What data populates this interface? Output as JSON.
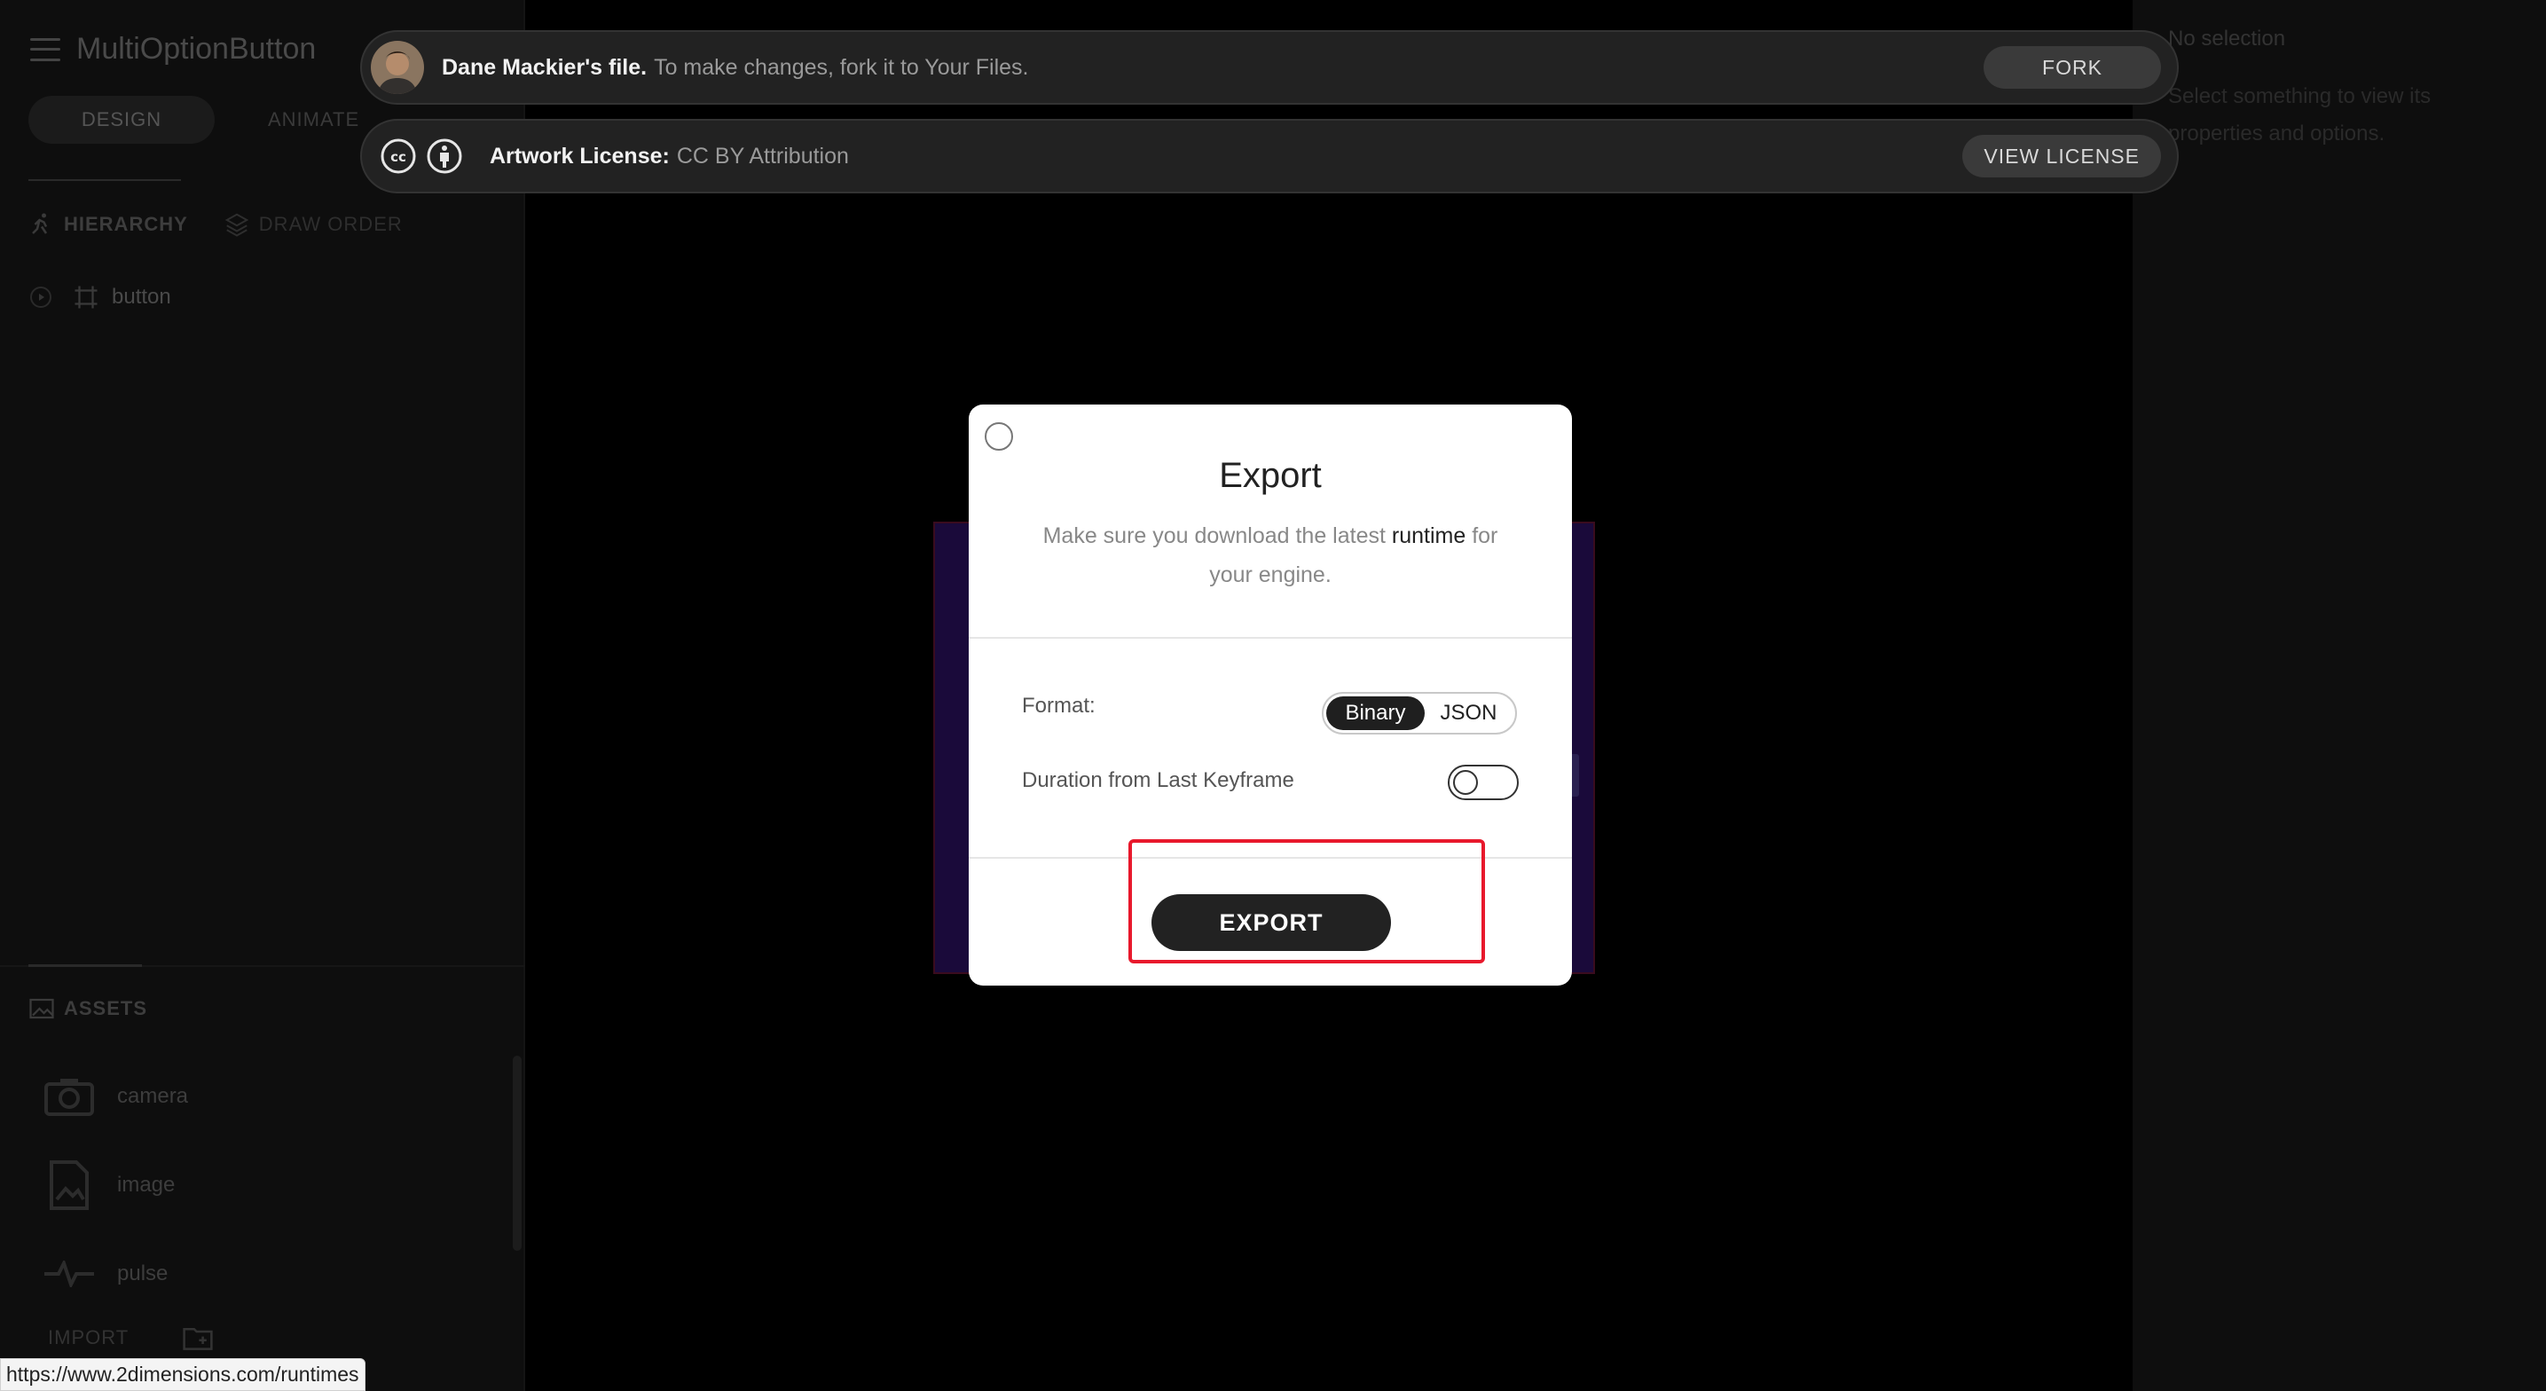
{
  "app": {
    "title": "MultiOptionButton"
  },
  "sidebar": {
    "mode_tabs": [
      {
        "label": "DESIGN"
      },
      {
        "label": "ANIMATE"
      }
    ],
    "panel_tabs": [
      {
        "label": "HIERARCHY"
      },
      {
        "label": "DRAW ORDER"
      }
    ],
    "hierarchy": [
      {
        "label": "button"
      }
    ],
    "assets": {
      "label": "ASSETS",
      "items": [
        {
          "label": "camera"
        },
        {
          "label": "image"
        },
        {
          "label": "pulse"
        }
      ],
      "import_label": "IMPORT"
    }
  },
  "banner_fork": {
    "owner": "Dane Mackier's file.",
    "message": "To make changes, fork it to Your Files.",
    "button": "FORK"
  },
  "banner_license": {
    "label": "Artwork License:",
    "license": "CC BY Attribution",
    "button": "VIEW LICENSE"
  },
  "right_panel": {
    "title": "No selection",
    "text": "Select something to view its properties and options."
  },
  "modal": {
    "title": "Export",
    "desc_prefix": "Make sure you download the latest ",
    "desc_link": "runtime",
    "desc_suffix": " for your engine.",
    "format_label": "Format:",
    "format_options": [
      "Binary",
      "JSON"
    ],
    "format_selected": "Binary",
    "duration_label": "Duration from Last Keyframe",
    "duration_enabled": false,
    "export_button": "EXPORT"
  },
  "status_url": "https://www.2dimensions.com/runtimes",
  "colors": {
    "highlight": "#e8192c",
    "modal_bg": "#ffffff",
    "banner_bg": "#222222"
  }
}
